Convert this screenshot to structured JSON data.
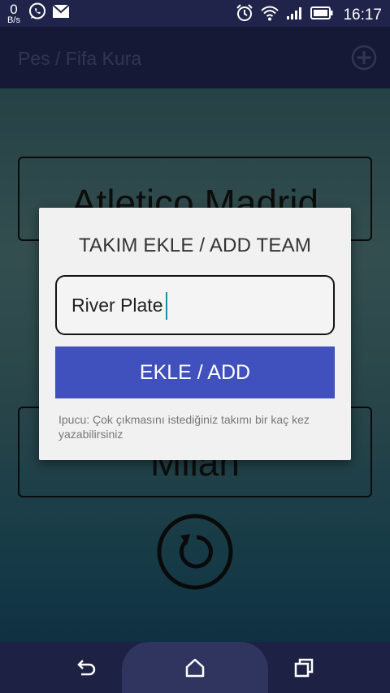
{
  "status_bar": {
    "speed_value": "0",
    "speed_unit": "B/s",
    "time": "16:17",
    "icons": [
      "whatsapp-icon",
      "mail-icon",
      "alarm-icon",
      "wifi-icon",
      "signal-icon",
      "battery-icon"
    ]
  },
  "app_bar": {
    "title": "Pes / Fifa Kura",
    "action_icon": "add-circle-icon"
  },
  "background": {
    "team_top": "Atletico Madrid",
    "team_bottom": "Milan",
    "shuffle_icon": "refresh-icon"
  },
  "dialog": {
    "title": "TAKIM EKLE / ADD TEAM",
    "input_value": "River Plate",
    "button_label": "EKLE / ADD",
    "hint": "Ipucu: Çok çıkmasını istediğiniz takımı bir kaç kez yazabilirsiniz"
  },
  "nav_bar": {
    "icons": [
      "back-icon",
      "home-icon",
      "recent-apps-icon"
    ]
  },
  "colors": {
    "app_bar": "#232956",
    "button": "#4051bd",
    "caret": "#1a8fa3"
  }
}
